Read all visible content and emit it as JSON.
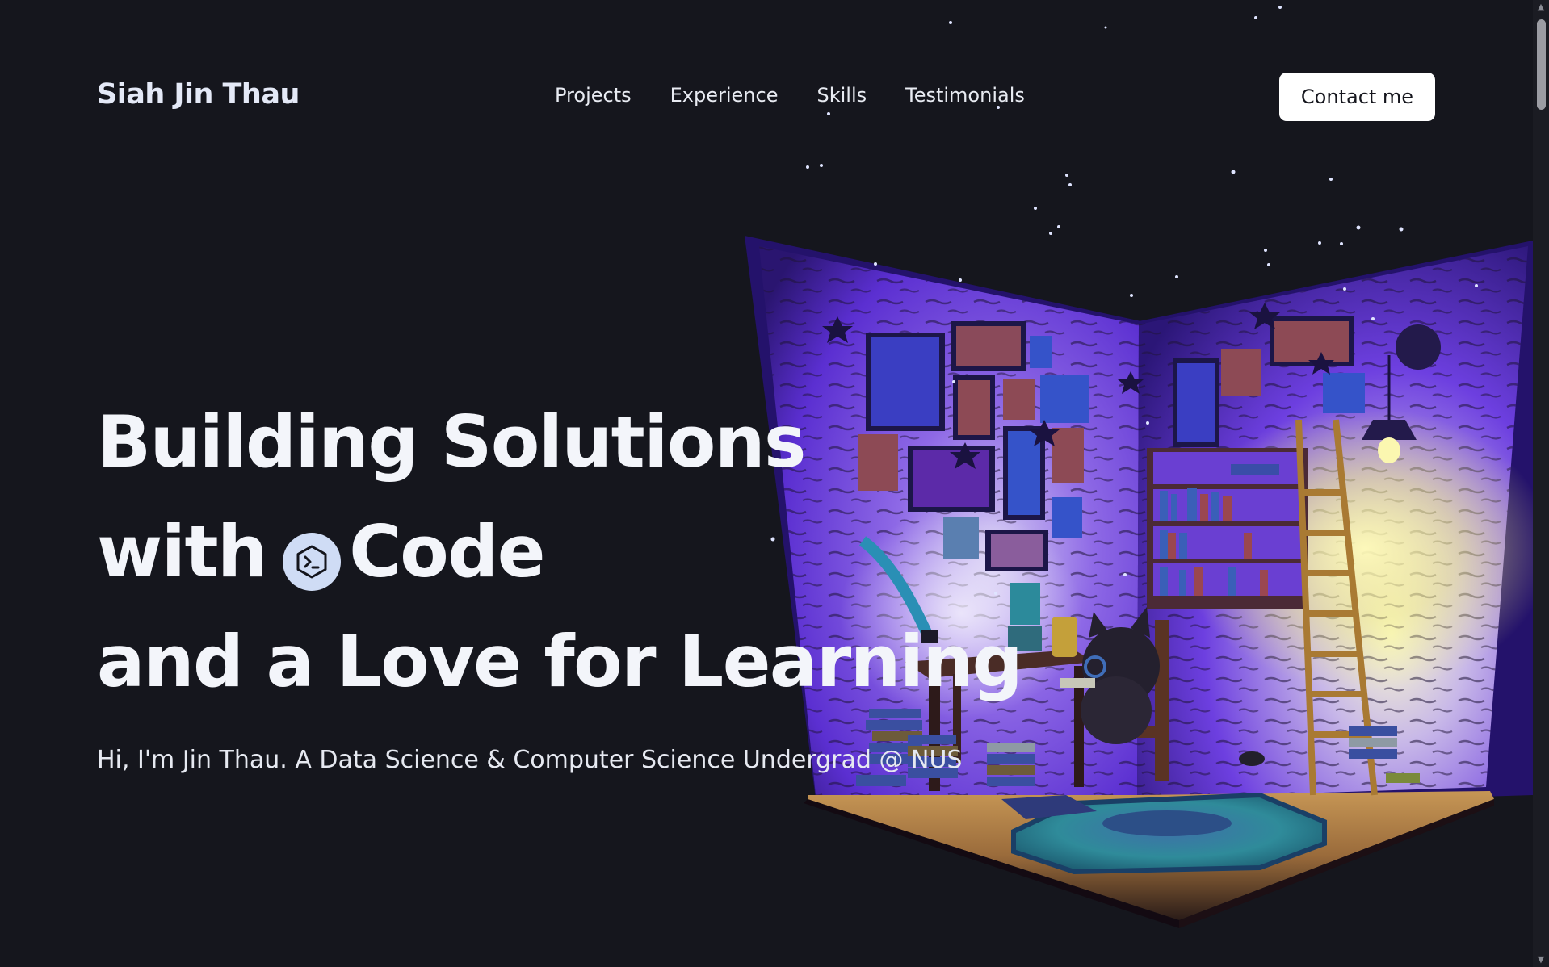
{
  "nav": {
    "brand": "Siah Jin Thau",
    "links": [
      "Projects",
      "Experience",
      "Skills",
      "Testimonials"
    ],
    "contact_label": "Contact me"
  },
  "hero": {
    "line1": "Building Solutions",
    "line2_prefix": "with",
    "line2_suffix": "Code",
    "line3": "and a Love for Learning",
    "subtitle": "Hi, I'm Jin Thau. A Data Science & Computer Science Undergrad @ NUS",
    "code_icon": "terminal-hexagon-icon"
  },
  "scene": {
    "description_icon": "isometric-library-room-illustration"
  },
  "colors": {
    "background": "#15161d",
    "text": "#f3f5fa",
    "button_bg": "#ffffff",
    "badge_bg": "#cfdcf5",
    "room_purple": "#5a2bd6",
    "lamp_yellow": "#f6f3a8"
  }
}
